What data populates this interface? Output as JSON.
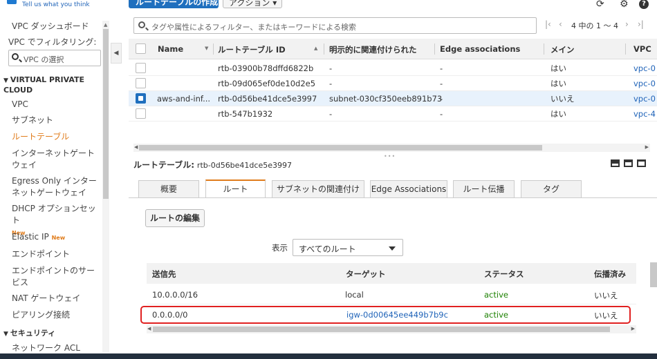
{
  "sidebar": {
    "tell_us": "Tell us what you think",
    "items_top": [
      {
        "label": "VPC ダッシュボード"
      }
    ],
    "filter_label": "VPC でフィルタリング:",
    "filter_placeholder": "VPC の選択",
    "section1": "VIRTUAL PRIVATE CLOUD",
    "items": [
      {
        "label": "VPC"
      },
      {
        "label": "サブネット"
      },
      {
        "label": "ルートテーブル",
        "active": true
      },
      {
        "label": "インターネットゲートウェイ"
      },
      {
        "label": "Egress Only インターネットゲートウェイ"
      },
      {
        "label": "DHCP オプションセット"
      },
      {
        "label": "Elastic IP"
      },
      {
        "label": "エンドポイント"
      },
      {
        "label": "エンドポイントのサービス"
      },
      {
        "label": "NAT ゲートウェイ"
      },
      {
        "label": "ピアリング接続"
      }
    ],
    "new_badge": "New",
    "section2": "セキュリティ",
    "items_bottom": [
      {
        "label": "ネットワーク ACL"
      }
    ]
  },
  "toolbar": {
    "create_label": "ルートテーブルの作成",
    "actions_label": "アクション ▾"
  },
  "search": {
    "placeholder": "タグや属性によるフィルター、またはキーワードによる検索"
  },
  "pager": {
    "text": "4 中の 1 ～ 4"
  },
  "table": {
    "headers": [
      "Name",
      "ルートテーブル ID",
      "明示的に関連付けられた",
      "Edge associations",
      "メイン",
      "VPC"
    ],
    "rows": [
      {
        "name": "",
        "id": "rtb-03900b78dffd6822b",
        "explicit": "-",
        "edge": "-",
        "main": "はい",
        "vpc": "vpc-0",
        "checked": false
      },
      {
        "name": "",
        "id": "rtb-09d065ef0de10d2e5",
        "explicit": "-",
        "edge": "-",
        "main": "はい",
        "vpc": "vpc-0",
        "checked": false
      },
      {
        "name": "aws-and-inf...",
        "id": "rtb-0d56be41dce5e3997",
        "explicit": "subnet-030cf350eeb891b73",
        "edge": "-",
        "main": "いいえ",
        "vpc": "vpc-0",
        "checked": true
      },
      {
        "name": "",
        "id": "rtb-547b1932",
        "explicit": "-",
        "edge": "-",
        "main": "はい",
        "vpc": "vpc-4",
        "checked": false
      }
    ]
  },
  "detail": {
    "title_label": "ルートテーブル:",
    "title_id": "rtb-0d56be41dce5e3997",
    "tabs": [
      "概要",
      "ルート",
      "サブネットの関連付け",
      "Edge Associations",
      "ルート伝播",
      "タグ"
    ],
    "active_tab": 1,
    "edit_routes_label": "ルートの編集",
    "show_label": "表示",
    "show_value": "すべてのルート",
    "routes_headers": [
      "送信先",
      "ターゲット",
      "ステータス",
      "伝播済み"
    ],
    "routes": [
      {
        "dest": "10.0.0.0/16",
        "target": "local",
        "status": "active",
        "propagated": "いいえ"
      },
      {
        "dest": "0.0.0.0/0",
        "target": "igw-0d00645ee449b7b9c",
        "status": "active",
        "propagated": "いいえ"
      }
    ]
  },
  "colors": {
    "accent_orange": "#e07b1a",
    "link_blue": "#1f63b8",
    "primary_blue": "#1f6fbe",
    "status_green": "#1d8102",
    "highlight_red": "#e02020"
  }
}
